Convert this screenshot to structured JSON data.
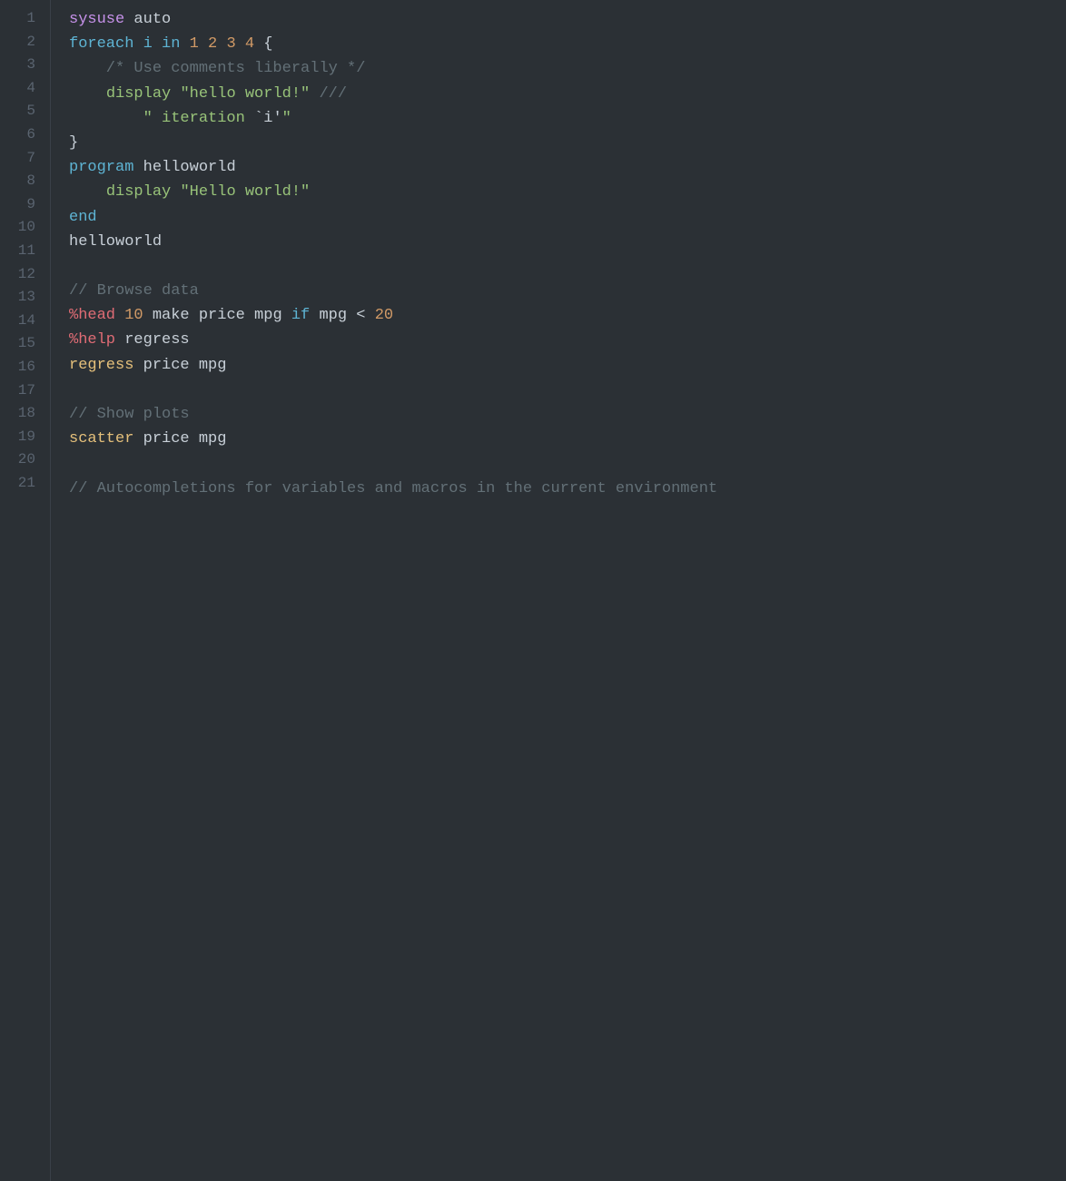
{
  "editor": {
    "background": "#2b3035",
    "lines": [
      {
        "number": 1,
        "tokens": [
          {
            "text": "sysuse",
            "class": "kw-purple"
          },
          {
            "text": " auto",
            "class": "normal"
          }
        ]
      },
      {
        "number": 2,
        "tokens": [
          {
            "text": "foreach",
            "class": "kw-blue"
          },
          {
            "text": " ",
            "class": "normal"
          },
          {
            "text": "i",
            "class": "kw-blue"
          },
          {
            "text": " ",
            "class": "normal"
          },
          {
            "text": "in",
            "class": "kw-blue"
          },
          {
            "text": " ",
            "class": "normal"
          },
          {
            "text": "1",
            "class": "kw-orange"
          },
          {
            "text": " ",
            "class": "normal"
          },
          {
            "text": "2",
            "class": "kw-orange"
          },
          {
            "text": " ",
            "class": "normal"
          },
          {
            "text": "3",
            "class": "kw-orange"
          },
          {
            "text": " ",
            "class": "normal"
          },
          {
            "text": "4",
            "class": "kw-orange"
          },
          {
            "text": " {",
            "class": "normal"
          }
        ]
      },
      {
        "number": 3,
        "tokens": [
          {
            "text": "    /* Use comments liberally */",
            "class": "comment"
          }
        ]
      },
      {
        "number": 4,
        "tokens": [
          {
            "text": "    ",
            "class": "normal"
          },
          {
            "text": "display",
            "class": "kw-green"
          },
          {
            "text": " ",
            "class": "normal"
          },
          {
            "text": "\"hello world!\"",
            "class": "str-string"
          },
          {
            "text": " ///",
            "class": "comment"
          }
        ]
      },
      {
        "number": 5,
        "tokens": [
          {
            "text": "        \" iteration ",
            "class": "str-string"
          },
          {
            "text": "`i'",
            "class": "backtick"
          },
          {
            "text": "\"",
            "class": "str-string"
          }
        ]
      },
      {
        "number": 6,
        "tokens": [
          {
            "text": "}",
            "class": "normal"
          }
        ]
      },
      {
        "number": 7,
        "tokens": [
          {
            "text": "program",
            "class": "kw-blue"
          },
          {
            "text": " helloworld",
            "class": "normal"
          }
        ]
      },
      {
        "number": 8,
        "tokens": [
          {
            "text": "    ",
            "class": "normal"
          },
          {
            "text": "display",
            "class": "kw-green"
          },
          {
            "text": " ",
            "class": "normal"
          },
          {
            "text": "\"Hello world!\"",
            "class": "str-string"
          }
        ]
      },
      {
        "number": 9,
        "tokens": [
          {
            "text": "end",
            "class": "kw-blue"
          }
        ]
      },
      {
        "number": 10,
        "tokens": [
          {
            "text": "helloworld",
            "class": "normal"
          }
        ]
      },
      {
        "number": 11,
        "tokens": []
      },
      {
        "number": 12,
        "tokens": [
          {
            "text": "// Browse data",
            "class": "comment"
          }
        ]
      },
      {
        "number": 13,
        "tokens": [
          {
            "text": "%head",
            "class": "pct-cmd"
          },
          {
            "text": " ",
            "class": "normal"
          },
          {
            "text": "10",
            "class": "kw-orange"
          },
          {
            "text": " make price mpg ",
            "class": "normal"
          },
          {
            "text": "if",
            "class": "kw-blue"
          },
          {
            "text": " mpg < ",
            "class": "normal"
          },
          {
            "text": "20",
            "class": "kw-orange"
          }
        ]
      },
      {
        "number": 14,
        "tokens": [
          {
            "text": "%help",
            "class": "pct-cmd"
          },
          {
            "text": " regress",
            "class": "normal"
          }
        ]
      },
      {
        "number": 15,
        "tokens": [
          {
            "text": "regress",
            "class": "kw-yellow"
          },
          {
            "text": " price mpg",
            "class": "normal"
          }
        ]
      },
      {
        "number": 16,
        "tokens": []
      },
      {
        "number": 17,
        "tokens": [
          {
            "text": "// Show plots",
            "class": "comment"
          }
        ]
      },
      {
        "number": 18,
        "tokens": [
          {
            "text": "scatter",
            "class": "kw-yellow"
          },
          {
            "text": " price mpg",
            "class": "normal"
          }
        ]
      },
      {
        "number": 19,
        "tokens": []
      },
      {
        "number": 20,
        "tokens": [
          {
            "text": "// Autocompletions for variables and macros in the current environment",
            "class": "comment"
          }
        ]
      },
      {
        "number": 21,
        "tokens": []
      }
    ]
  }
}
